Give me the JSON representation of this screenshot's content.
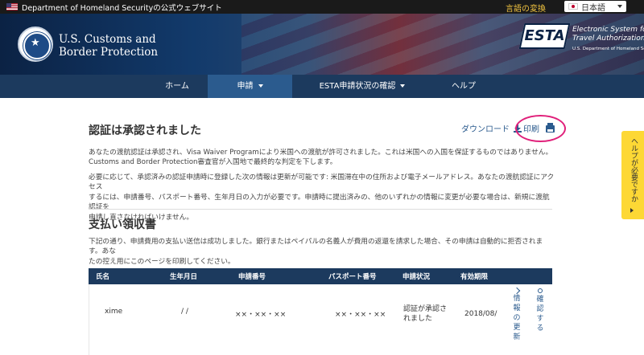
{
  "topbar": {
    "gov_label": "Department of Homeland Securityの公式ウェブサイト",
    "lang_label": "言語の変換",
    "lang_value": "日本語"
  },
  "header": {
    "agency_line1": "U.S. Customs and",
    "agency_line2": "Border Protection",
    "esta_mark": "ESTA",
    "esta_line1": "Electronic System for",
    "esta_line2": "Travel Authorization",
    "esta_sub": "U.S. Department of Homeland Security"
  },
  "nav": {
    "home": "ホーム",
    "apply": "申請",
    "status": "ESTA申請状況の確認",
    "help": "ヘルプ"
  },
  "main": {
    "title": "認証は承認されました",
    "download_label": "ダウンロード",
    "print_label": "印刷",
    "para1_line1": "あなたの渡航認証は承認され、Visa Waiver Programにより米国への渡航が許可されました。これは米国への入国を保証するものではありません。",
    "para1_line2": "Customs and Border Protection審査官が入国地で最終的な判定を下します。",
    "para2_line1": "必要に応じて、承認済みの認証申請時に登録した次の情報は更新が可能です: 米国滞在中の住所および電子メールアドレス。あなたの渡航認証にアクセス",
    "para2_line2": "するには、申請番号、パスポート番号、生年月日の入力が必要です。申請時に提出済みの、他のいずれかの情報に変更が必要な場合は、新規に渡航認証を",
    "para2_line3": "申請し直さなければいけません。",
    "section_title": "支払い領収書",
    "para3_line1": "下記の通り、申請費用の支払い送信は成功しました。銀行またはペイパルの名義人が費用の返還を請求した場合、その申請は自動的に拒否されます。あな",
    "para3_line2": "たの控え用にこのページを印刷してください。"
  },
  "table": {
    "headers": [
      "氏名",
      "生年月日",
      "申請番号",
      "パスポート番号",
      "申請状況",
      "有効期限"
    ],
    "row": {
      "name": "xime",
      "dob": "/  /",
      "app_no": "××・××・××",
      "passport": "××・××・××",
      "status_line1": "認証が承認さ",
      "status_line2": "れました",
      "expiry": "2018/08/",
      "update_label": "情報の更新",
      "confirm_label": "確認する"
    }
  },
  "help_tab": {
    "label": "ヘルプが必要ですか"
  }
}
